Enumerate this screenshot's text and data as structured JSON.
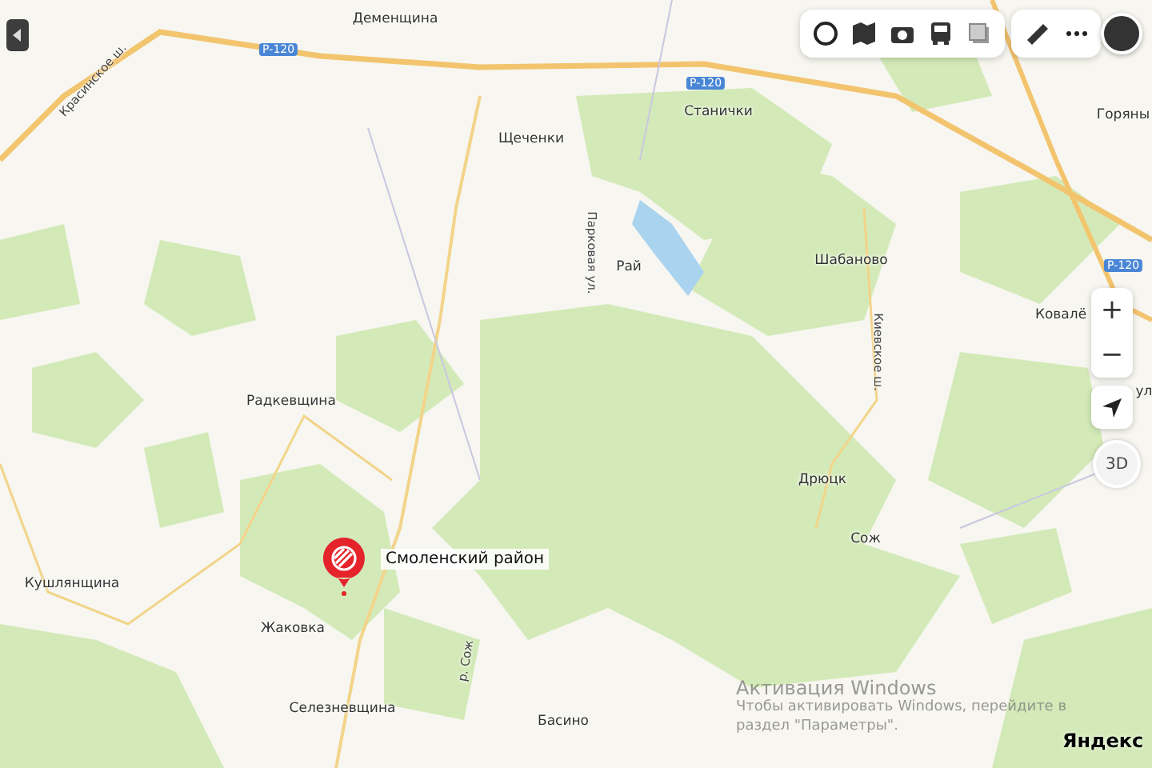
{
  "map": {
    "labels": [
      {
        "kind": "place",
        "text": "Деменщина"
      },
      {
        "kind": "badge",
        "text": "Р-120"
      },
      {
        "kind": "road",
        "text": "Красинское ш."
      },
      {
        "kind": "badge",
        "text": "Р-120"
      },
      {
        "kind": "place",
        "text": "Станички"
      },
      {
        "kind": "place",
        "text": "Горяны"
      },
      {
        "kind": "place",
        "text": "Щеченки"
      },
      {
        "kind": "road",
        "text": "Парковая ул."
      },
      {
        "kind": "place",
        "text": "Рай"
      },
      {
        "kind": "place",
        "text": "Шабаново"
      },
      {
        "kind": "badge",
        "text": "Р-120"
      },
      {
        "kind": "place",
        "text": "Ковалё"
      },
      {
        "kind": "road",
        "text": "Киевское ш."
      },
      {
        "kind": "place",
        "text": "ул"
      },
      {
        "kind": "place",
        "text": "Радкевщина"
      },
      {
        "kind": "place",
        "text": "Дрюцк"
      },
      {
        "kind": "place",
        "text": "Сож"
      },
      {
        "kind": "place",
        "text": "Кушлянщина"
      },
      {
        "kind": "place",
        "text": "Жаковка"
      },
      {
        "kind": "river",
        "text": "р. Сож"
      },
      {
        "kind": "place",
        "text": "Селезневщина"
      },
      {
        "kind": "place",
        "text": "Басино"
      }
    ],
    "pin": {
      "label": "Смоленский район"
    },
    "zoom_buttons": [
      "+",
      "−"
    ],
    "compass": {
      "label": "3D"
    },
    "logo": "Яндекс"
  },
  "os_notice": {
    "title": "Активация Windows",
    "text": "Чтобы активировать Windows, перейдите в раздел \"Параметры\"."
  }
}
